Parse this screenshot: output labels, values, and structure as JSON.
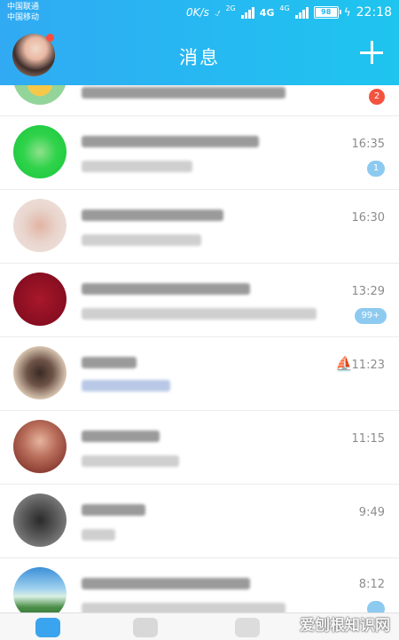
{
  "status_bar": {
    "carrier1": "中国联通",
    "carrier2": "中国移动",
    "speed": "0K/s",
    "net1": "2G",
    "net2": "4G",
    "net3": "4G",
    "battery": "98",
    "time": "22:18"
  },
  "header": {
    "title": "消息",
    "plus_icon": "plus-icon",
    "brand_color": "#2ab4f2"
  },
  "chats": [
    {
      "time": "",
      "badge": "2",
      "badge_color": "#f4533f"
    },
    {
      "time": "16:35",
      "badge": "1",
      "badge_color": "#8dcaf0"
    },
    {
      "time": "16:30",
      "badge": ""
    },
    {
      "time": "13:29",
      "badge": "99+",
      "badge_color": "#8dcaf0"
    },
    {
      "time": "11:23",
      "badge": "",
      "status_icon": "sailboat-icon"
    },
    {
      "time": "11:15",
      "badge": ""
    },
    {
      "time": "9:49",
      "badge": ""
    },
    {
      "time": "8:12",
      "badge": "",
      "badge_color": "#8dcaf0"
    }
  ],
  "watermark": "爱刨根知识网"
}
